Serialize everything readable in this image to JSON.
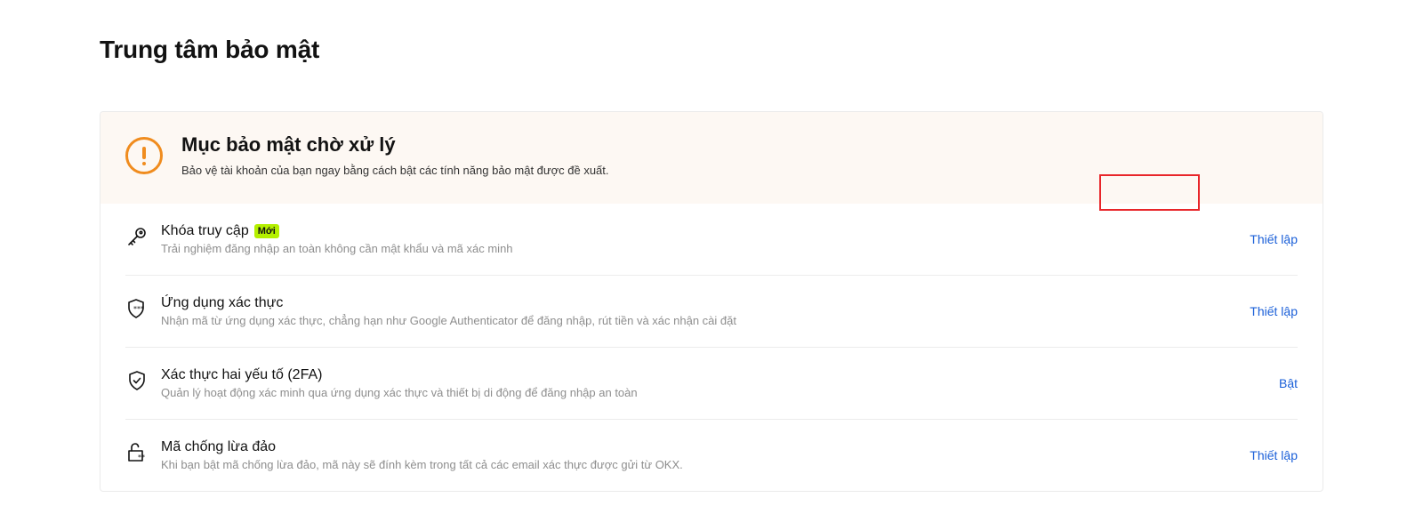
{
  "page": {
    "title": "Trung tâm bảo mật"
  },
  "banner": {
    "title": "Mục bảo mật chờ xử lý",
    "description": "Bảo vệ tài khoản của bạn ngay bằng cách bật các tính năng bảo mật được đề xuất.",
    "icon": "warning-exclamation-icon",
    "accent_color": "#f08c1e"
  },
  "items": [
    {
      "title": "Khóa truy cập",
      "badge": "Mới",
      "description": "Trải nghiệm đăng nhập an toàn không cần mật khẩu và mã xác minh",
      "action": "Thiết lập",
      "icon": "key-icon"
    },
    {
      "title": "Ứng dụng xác thực",
      "description": "Nhận mã từ ứng dụng xác thực, chẳng hạn như Google Authenticator để đăng nhập, rút tiền và xác nhận cài đặt",
      "action": "Thiết lập",
      "icon": "shield-password-icon"
    },
    {
      "title": "Xác thực hai yếu tố (2FA)",
      "description": "Quản lý hoạt động xác minh qua ứng dụng xác thực và thiết bị di động để đăng nhập an toàn",
      "action": "Bật",
      "icon": "shield-check-icon"
    },
    {
      "title": "Mã chống lừa đảo",
      "description": "Khi bạn bật mã chống lừa đảo, mã này sẽ đính kèm trong tất cả các email xác thực được gửi từ OKX.",
      "action": "Thiết lập",
      "icon": "unlock-password-icon"
    }
  ],
  "colors": {
    "link": "#1a5fd8",
    "badge_bg": "#b4f000",
    "highlight_border": "#e8262a"
  }
}
